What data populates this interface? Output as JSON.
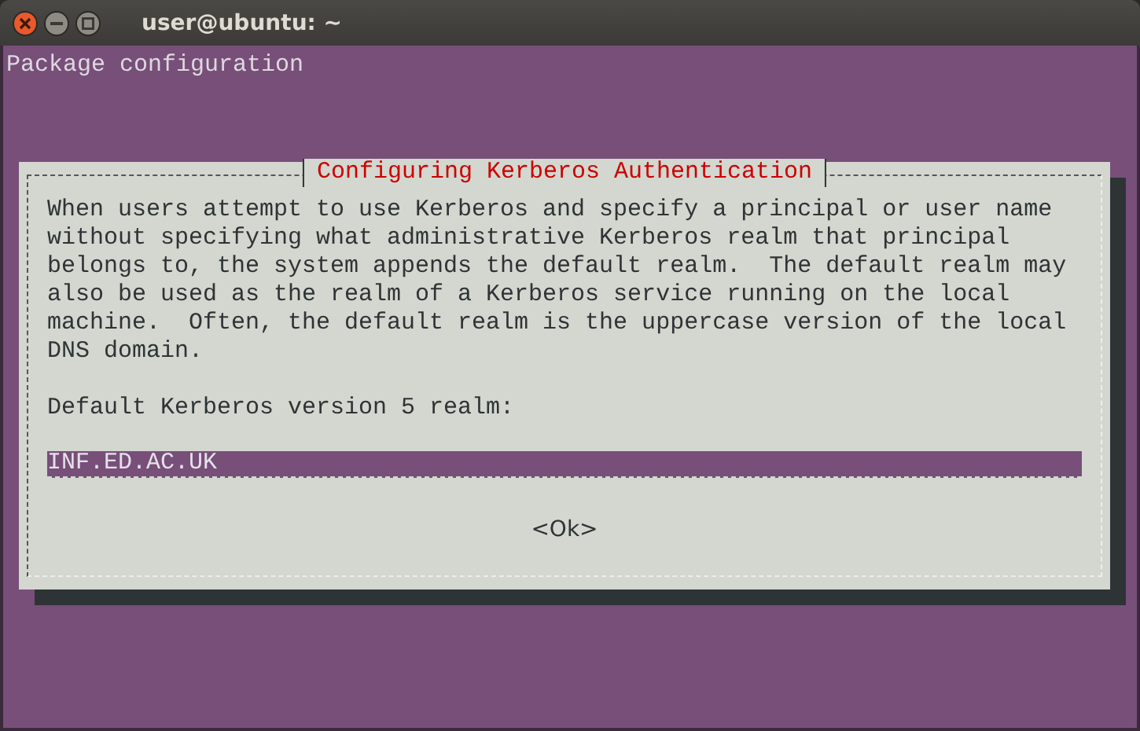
{
  "window": {
    "title": "user@ubuntu: ~"
  },
  "terminal": {
    "header": "Package configuration"
  },
  "dialog": {
    "title": "Configuring Kerberos Authentication",
    "description": "When users attempt to use Kerberos and specify a principal or user name\nwithout specifying what administrative Kerberos realm that principal\nbelongs to, the system appends the default realm.  The default realm may\nalso be used as the realm of a Kerberos service running on the local\nmachine.  Often, the default realm is the uppercase version of the local\nDNS domain.",
    "prompt": "Default Kerberos version 5 realm:",
    "field": {
      "value": "INF.ED.AC.UK"
    },
    "buttons": [
      {
        "label": "<Ok>"
      }
    ]
  }
}
